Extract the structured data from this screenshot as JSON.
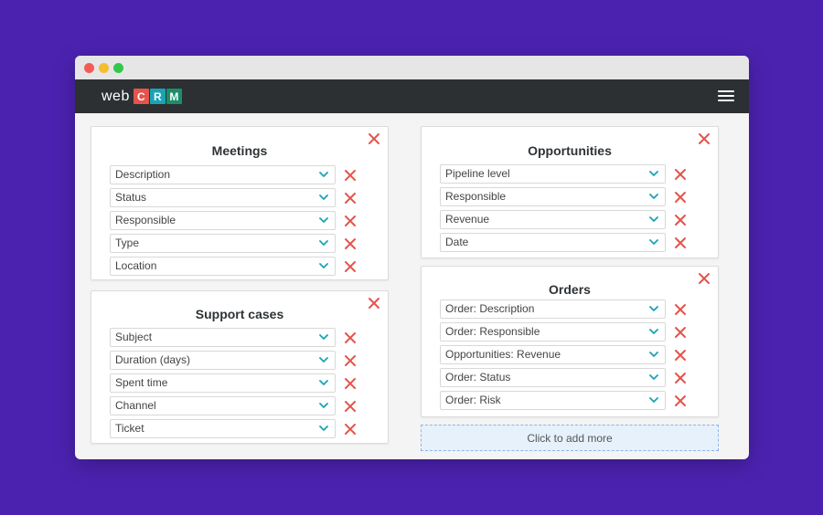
{
  "logo": {
    "text": "web",
    "letters": [
      {
        "char": "C",
        "color": "#e5534b"
      },
      {
        "char": "R",
        "color": "#1aa3b4"
      },
      {
        "char": "M",
        "color": "#1a8f67"
      }
    ]
  },
  "menu_icon": "hamburger-icon",
  "colors": {
    "remove": "#e5534b",
    "chevron": "#1aa3b4",
    "appbar": "#2c3033",
    "background": "#4b22b0"
  },
  "cards": {
    "meetings": {
      "title": "Meetings",
      "fields": [
        "Description",
        "Status",
        "Responsible",
        "Type",
        "Location"
      ]
    },
    "support_cases": {
      "title": "Support cases",
      "fields": [
        "Subject",
        "Duration (days)",
        "Spent time",
        "Channel",
        "Ticket"
      ]
    },
    "opportunities": {
      "title": "Opportunities",
      "fields": [
        "Pipeline level",
        "Responsible",
        "Revenue",
        "Date"
      ]
    },
    "orders": {
      "title": "Orders",
      "fields": [
        "Order: Description",
        "Order: Responsible",
        "Opportunities: Revenue",
        "Order: Status",
        "Order: Risk"
      ]
    }
  },
  "add_more_label": "Click to add more"
}
